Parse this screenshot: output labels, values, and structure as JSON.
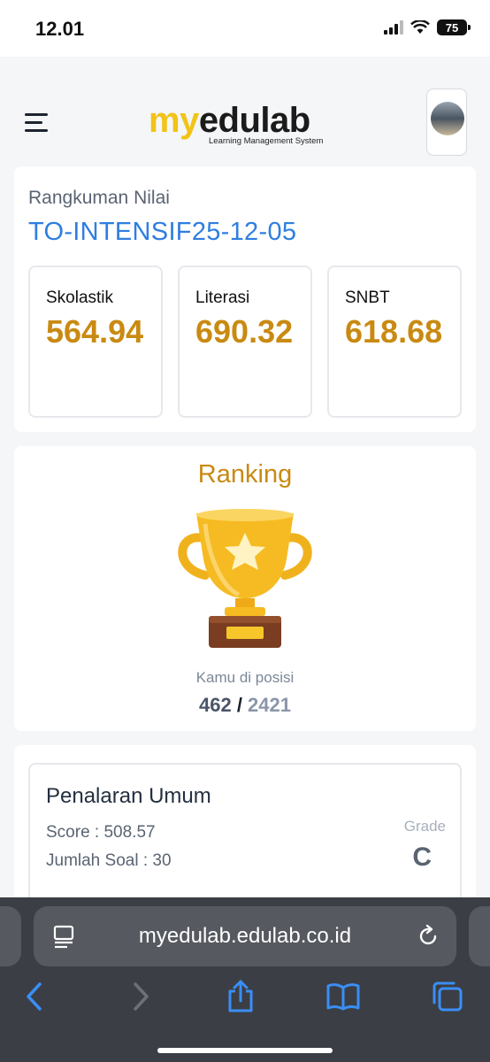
{
  "status_bar": {
    "time": "12.01",
    "battery": "75"
  },
  "header": {
    "logo_my": "my",
    "logo_edulab": "edulab",
    "logo_subtitle": "Learning Management System"
  },
  "summary": {
    "label": "Rangkuman Nilai",
    "code": "TO-INTENSIF25-12-05",
    "scores": [
      {
        "name": "Skolastik",
        "value": "564.94"
      },
      {
        "name": "Literasi",
        "value": "690.32"
      },
      {
        "name": "SNBT",
        "value": "618.68"
      }
    ]
  },
  "ranking": {
    "title": "Ranking",
    "caption": "Kamu di posisi",
    "position": "462",
    "separator": " / ",
    "total": "2421"
  },
  "subtest": {
    "title": "Penalaran Umum",
    "score": "Score : 508.57",
    "count": "Jumlah Soal : 30",
    "grade_label": "Grade",
    "grade": "C"
  },
  "browser": {
    "url": "myedulab.edulab.co.id"
  },
  "colors": {
    "accent_gold": "#c98a12",
    "link_blue": "#2f7ee0",
    "safari_blue": "#3a8ef6",
    "logo_yellow": "#f2c318"
  },
  "icons": [
    "menu-icon",
    "trophy-icon",
    "reader-icon",
    "reload-icon",
    "back-icon",
    "forward-icon",
    "share-icon",
    "bookmarks-icon",
    "tabs-icon"
  ]
}
